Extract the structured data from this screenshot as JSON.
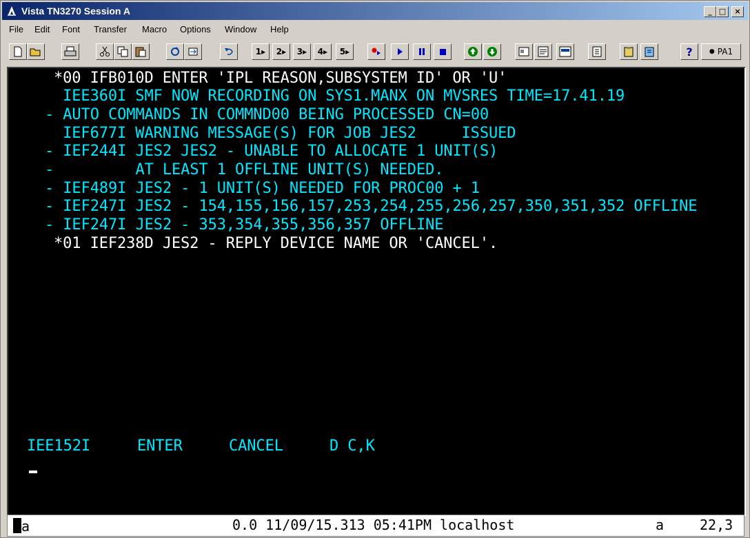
{
  "window": {
    "title": "Vista TN3270 Session A",
    "controls": [
      "_",
      "□",
      "×"
    ]
  },
  "menu": [
    "File",
    "Edit",
    "Font",
    "Transfer",
    "Macro",
    "Options",
    "Window",
    "Help"
  ],
  "toolbar": {
    "macro_labels": [
      "1",
      "2",
      "3",
      "4",
      "5"
    ],
    "help_label": "?",
    "pa1_label": "PA1"
  },
  "screen": {
    "lines": [
      "*00 IFB010D ENTER 'IPL REASON,SUBSYSTEM ID' OR 'U'",
      " IEE360I SMF NOW RECORDING ON SYS1.MANX ON MVSRES TIME=17.41.19",
      "- AUTO COMMANDS IN COMMND00 BEING PROCESSED CN=00",
      " IEF677I WARNING MESSAGE(S) FOR JOB JES2     ISSUED",
      "- IEF244I JES2 JES2 - UNABLE TO ALLOCATE 1 UNIT(S)",
      "-         AT LEAST 1 OFFLINE UNIT(S) NEEDED.",
      "- IEF489I JES2 - 1 UNIT(S) NEEDED FOR PROC00 + 1",
      "- IEF247I JES2 - 154,155,156,157,253,254,255,256,257,350,351,352 OFFLINE",
      "- IEF247I JES2 - 353,354,355,356,357 OFFLINE",
      "*01 IEF238D JES2 - REPLY DEVICE NAME OR 'CANCEL'."
    ],
    "footer": {
      "msg_id": "IEE152I",
      "enter": "ENTER",
      "cancel": "CANCEL",
      "cmd": "D C,K"
    }
  },
  "status": {
    "mode": "Ma",
    "info": "0.0 11/09/15.313 05:41PM localhost",
    "flag": "a",
    "cursor_pos": "22,3"
  },
  "colors": {
    "terminal_bg": "#000000",
    "terminal_text": "#00e8ff",
    "highlight_text": "#ffffff"
  }
}
